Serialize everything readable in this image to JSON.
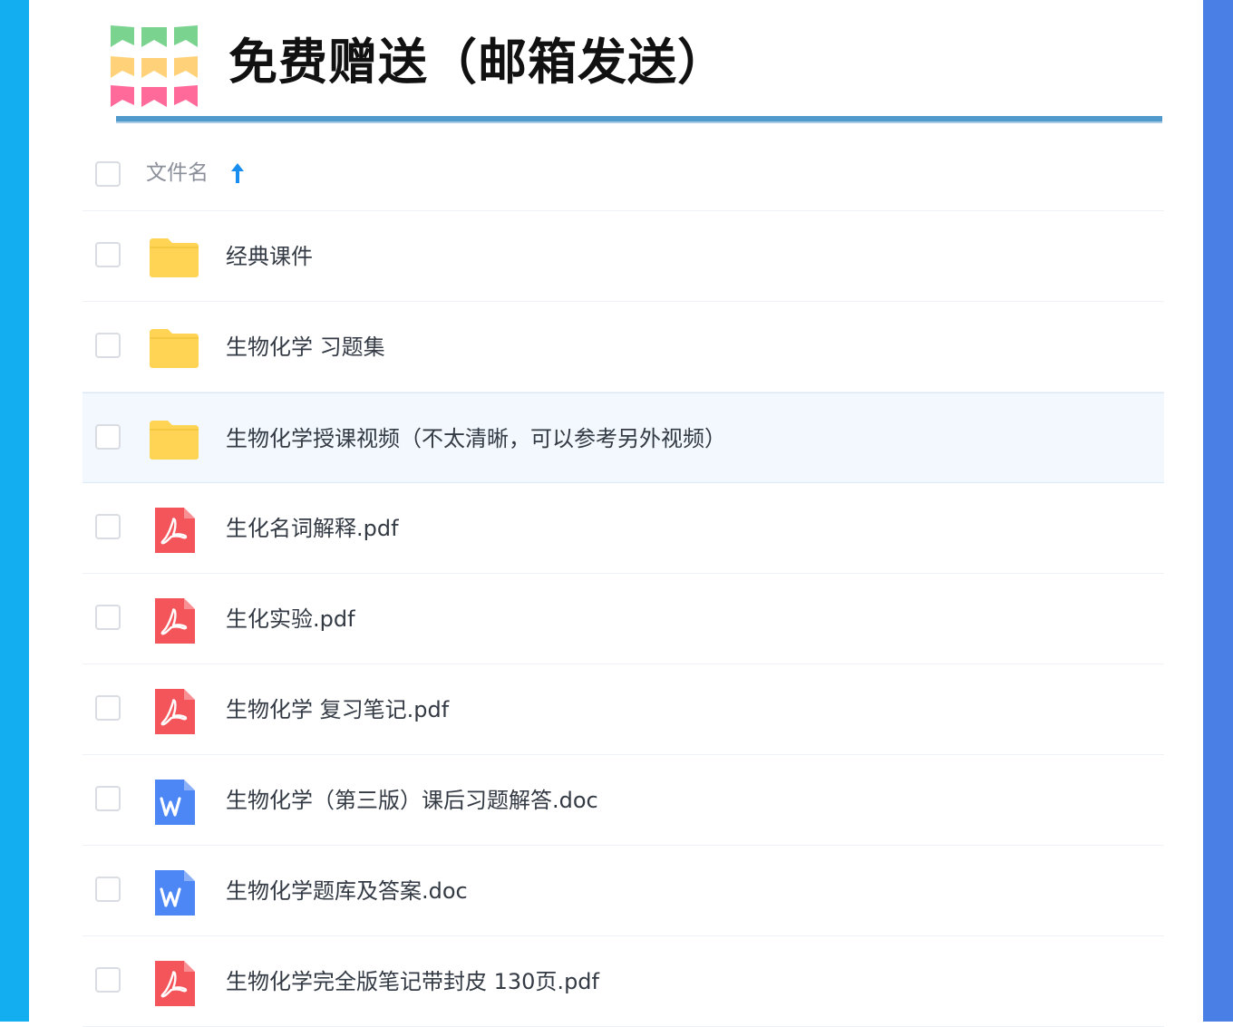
{
  "title": "免费赠送（邮箱发送）",
  "colors": {
    "left_bar": "#12aef0",
    "right_bar": "#4a7fe6",
    "rule": "#4f9acb",
    "folder": "#ffd454",
    "pdf": "#f4555a",
    "doc": "#4d86f5",
    "sort_arrow": "#1a8df0",
    "bunting_top": "#7ad38f",
    "bunting_mid": "#ffd27a",
    "bunting_bottom": "#ff6a9a"
  },
  "file_list": {
    "header": {
      "name_label": "文件名",
      "sort_icon": "arrow-up-icon"
    },
    "rows": [
      {
        "type": "folder",
        "name": "经典课件"
      },
      {
        "type": "folder",
        "name": "生物化学 习题集"
      },
      {
        "type": "folder",
        "name": "生物化学授课视频（不太清晰，可以参考另外视频）",
        "highlighted": true
      },
      {
        "type": "pdf",
        "name": "生化名词解释.pdf"
      },
      {
        "type": "pdf",
        "name": "生化实验.pdf"
      },
      {
        "type": "pdf",
        "name": "生物化学 复习笔记.pdf"
      },
      {
        "type": "doc",
        "name": "生物化学（第三版）课后习题解答.doc"
      },
      {
        "type": "doc",
        "name": "生物化学题库及答案.doc"
      },
      {
        "type": "pdf",
        "name": "生物化学完全版笔记带封皮 130页.pdf"
      }
    ]
  }
}
